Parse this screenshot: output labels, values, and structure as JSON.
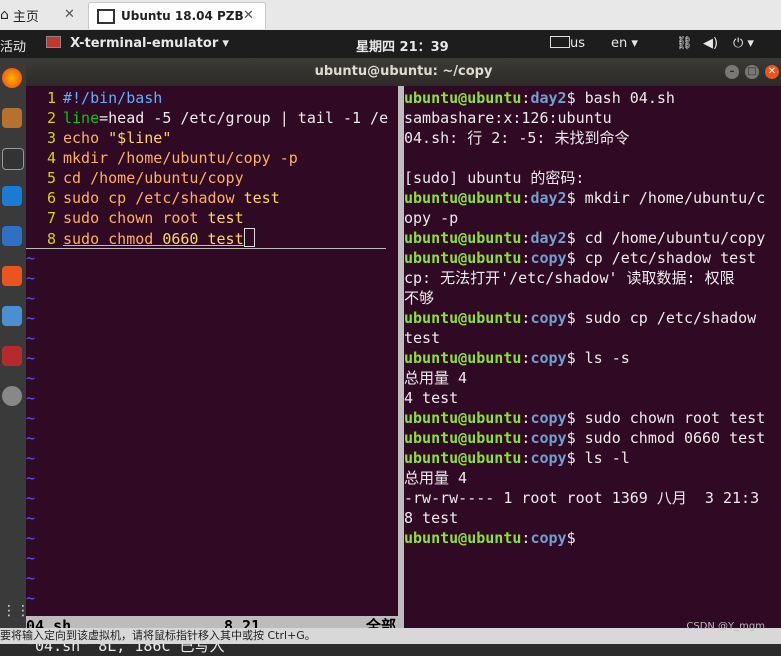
{
  "host_tabs": {
    "home_label": "主页",
    "vm_label": "Ubuntu 18.04 PZB"
  },
  "panel": {
    "activities": "活动",
    "app_menu": "X-terminal-emulator",
    "clock": "星期四 21：39",
    "keyboard": "us",
    "language": "en"
  },
  "window": {
    "title": "ubuntu@ubuntu: ~/copy"
  },
  "vim": {
    "lines": [
      {
        "n": "1",
        "segments": [
          {
            "t": "#!/bin/bash",
            "c": "shebang"
          }
        ]
      },
      {
        "n": "2",
        "segments": [
          {
            "t": "line",
            "c": "var"
          },
          {
            "t": "=head -5 /etc/group | tail -1 /e",
            "c": "wht"
          }
        ]
      },
      {
        "n": "3",
        "segments": [
          {
            "t": "echo ",
            "c": "ora"
          },
          {
            "t": "\"$line\"",
            "c": "str"
          }
        ]
      },
      {
        "n": "4",
        "segments": [
          {
            "t": "mkdir /home/ubuntu/copy -p",
            "c": "ora"
          }
        ]
      },
      {
        "n": "5",
        "segments": [
          {
            "t": "cd /home/ubuntu/copy",
            "c": "ora"
          }
        ]
      },
      {
        "n": "6",
        "segments": [
          {
            "t": "sudo cp /etc/shadow ",
            "c": "ora"
          },
          {
            "t": "test",
            "c": "str"
          }
        ]
      },
      {
        "n": "7",
        "segments": [
          {
            "t": "sudo chown root ",
            "c": "ora"
          },
          {
            "t": "test",
            "c": "str"
          }
        ]
      },
      {
        "n": "8",
        "segments": [
          {
            "t": "sudo chmod ",
            "c": "ora"
          },
          {
            "t": "0660",
            "c": "str"
          },
          {
            "t": " ",
            "c": "ora"
          },
          {
            "t": "test",
            "c": "str"
          }
        ]
      }
    ],
    "tilde": "~",
    "status_file": "04.sh",
    "status_pos": "8,21",
    "status_all": "全部",
    "message": "\"04.sh\" 8L, 186C 已写入"
  },
  "shell": {
    "user": "ubuntu@ubuntu",
    "lines": [
      {
        "type": "prompt",
        "dir": "day2",
        "cmd": "bash 04.sh"
      },
      {
        "type": "out",
        "text": "sambashare:x:126:ubuntu"
      },
      {
        "type": "out",
        "text": "04.sh: 行 2: -5: 未找到命令"
      },
      {
        "type": "out",
        "text": ""
      },
      {
        "type": "out",
        "text": "[sudo] ubuntu 的密码:"
      },
      {
        "type": "prompt",
        "dir": "day2",
        "cmd": "mkdir /home/ubuntu/c"
      },
      {
        "type": "out",
        "text": "opy -p"
      },
      {
        "type": "prompt",
        "dir": "day2",
        "cmd": "cd /home/ubuntu/copy"
      },
      {
        "type": "prompt",
        "dir": "copy",
        "cmd": "cp /etc/shadow test"
      },
      {
        "type": "out",
        "text": "cp: 无法打开'/etc/shadow' 读取数据: 权限"
      },
      {
        "type": "out",
        "text": "不够"
      },
      {
        "type": "prompt",
        "dir": "copy",
        "cmd": "sudo cp /etc/shadow"
      },
      {
        "type": "out",
        "text": "test"
      },
      {
        "type": "prompt",
        "dir": "copy",
        "cmd": "ls -s"
      },
      {
        "type": "out",
        "text": "总用量 4"
      },
      {
        "type": "out",
        "text": "4 test"
      },
      {
        "type": "prompt",
        "dir": "copy",
        "cmd": "sudo chown root test"
      },
      {
        "type": "prompt",
        "dir": "copy",
        "cmd": "sudo chmod 0660 test"
      },
      {
        "type": "prompt",
        "dir": "copy",
        "cmd": "ls -l"
      },
      {
        "type": "out",
        "text": "总用量 4"
      },
      {
        "type": "out",
        "text": "-rw-rw---- 1 root root 1369 八月  3 21:3"
      },
      {
        "type": "out",
        "text": "8 test"
      },
      {
        "type": "prompt",
        "dir": "copy",
        "cmd": ""
      }
    ]
  },
  "bottom_hint": "要将输入定向到该虚拟机，请将鼠标指针移入其中或按 Ctrl+G。",
  "watermark": "CSDN @Y_mgm",
  "icons": [
    "home-icon",
    "vm-tab-icon",
    "close-icon",
    "network-icon",
    "volume-icon",
    "power-icon",
    "firefox-icon",
    "files-icon",
    "terminal-icon",
    "vscode-icon",
    "help-icon",
    "software-icon",
    "apps-grid-icon"
  ]
}
